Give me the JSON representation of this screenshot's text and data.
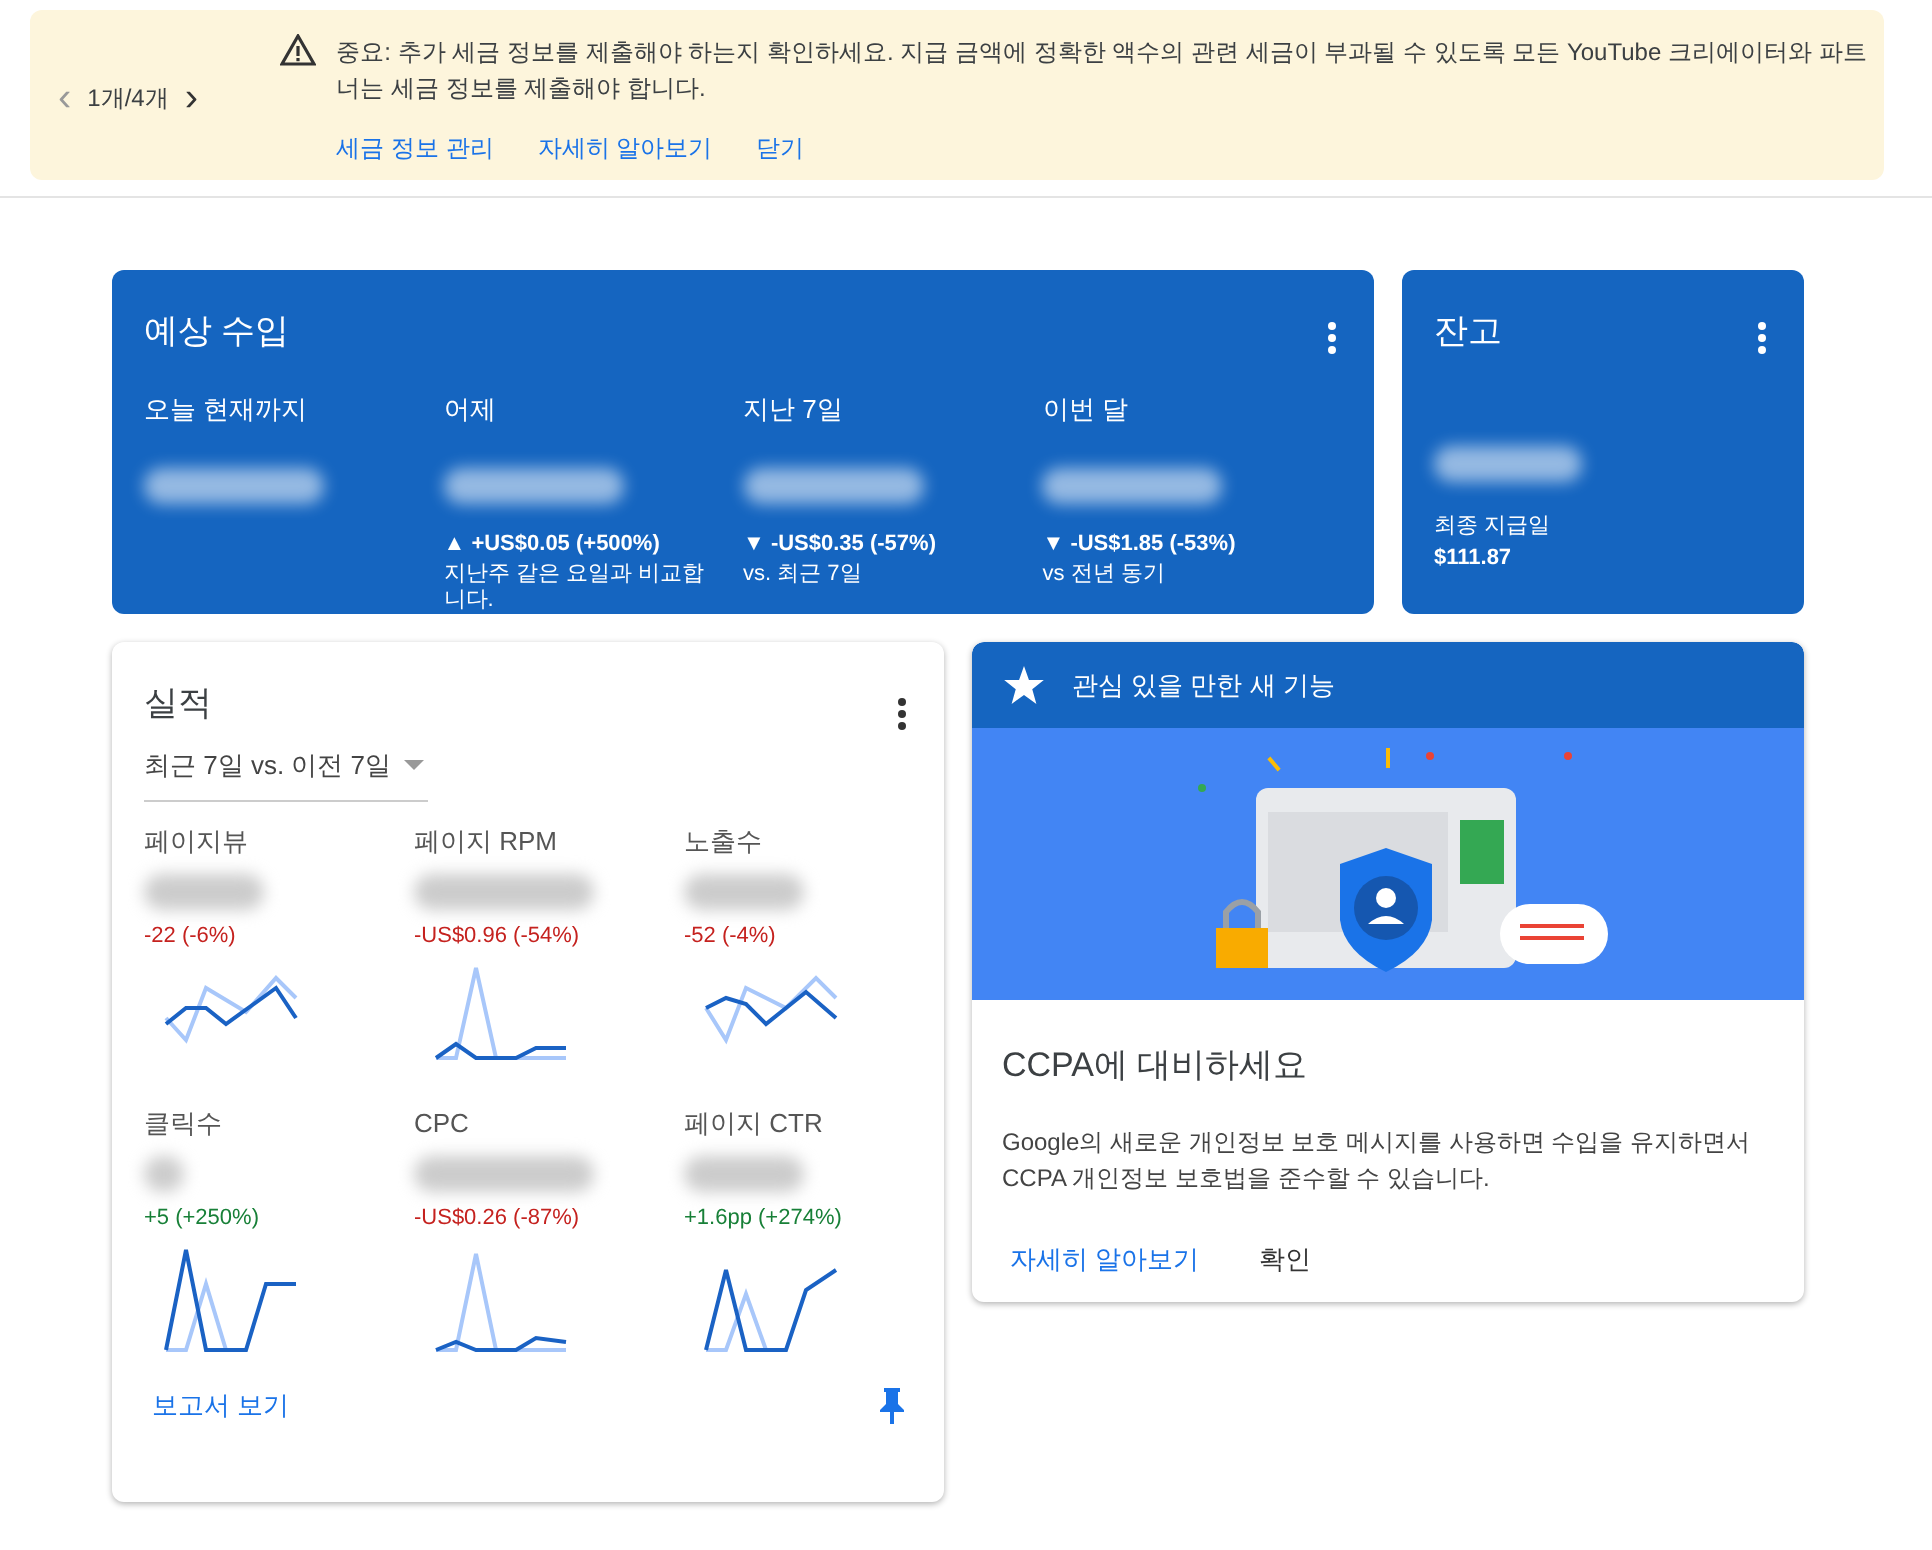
{
  "banner": {
    "pager": {
      "prev": "‹",
      "count": "1개/4개",
      "next": "›"
    },
    "message": "중요: 추가 세금 정보를 제출해야 하는지 확인하세요. 지급 금액에 정확한 액수의 관련 세금이 부과될 수 있도록 모든 YouTube 크리에이터와 파트너는 세금 정보를 제출해야 합니다.",
    "links": [
      "세금 정보 관리",
      "자세히 알아보기",
      "닫기"
    ]
  },
  "earnings": {
    "title": "예상 수입",
    "columns": [
      {
        "label": "오늘 현재까지"
      },
      {
        "label": "어제",
        "change": "▲ +US$0.05 (+500%)",
        "note": "지난주 같은 요일과 비교합니다."
      },
      {
        "label": "지난 7일",
        "change": "▼ -US$0.35 (-57%)",
        "note": "vs. 최근 7일"
      },
      {
        "label": "이번 달",
        "change": "▼ -US$1.85 (-53%)",
        "note": "vs 전년 동기"
      }
    ]
  },
  "balance": {
    "title": "잔고",
    "last_payment_label": "최종 지급일",
    "last_payment": "$111.87"
  },
  "performance": {
    "title": "실적",
    "range": "최근 7일 vs. 이전 7일",
    "metrics": [
      {
        "label": "페이지뷰",
        "change": "-22 (-6%)",
        "negative": true
      },
      {
        "label": "페이지 RPM",
        "change": "-US$0.96 (-54%)",
        "negative": true
      },
      {
        "label": "노출수",
        "change": "-52 (-4%)",
        "negative": true
      },
      {
        "label": "클릭수",
        "change": "+5 (+250%)",
        "negative": false
      },
      {
        "label": "CPC",
        "change": "-US$0.26 (-87%)",
        "negative": true
      },
      {
        "label": "페이지 CTR",
        "change": "+1.6pp (+274%)",
        "negative": false
      }
    ],
    "report_link": "보고서 보기",
    "pinned": true
  },
  "feature": {
    "header": "관심 있을 만한 새 기능",
    "title": "CCPA에 대비하세요",
    "body": "Google의 새로운 개인정보 보호 메시지를 사용하면 수입을 유지하면서 CCPA 개인정보 보호법을 준수할 수 있습니다.",
    "actions": [
      "자세히 알아보기",
      "확인"
    ]
  }
}
